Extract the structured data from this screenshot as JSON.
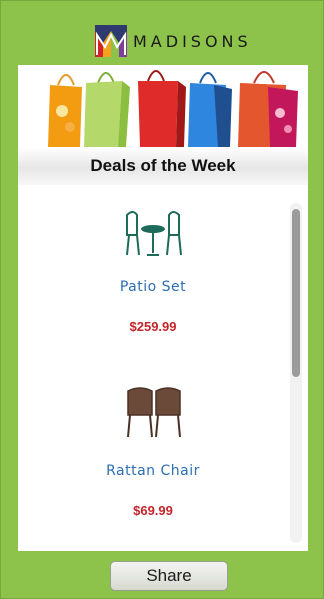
{
  "brand": {
    "name": "MADISONS",
    "logo_icon": "madisons-m-logo",
    "colors": {
      "frame_green": "#8dc24b",
      "link_blue": "#2c6fb3",
      "price_red": "#c3252a"
    }
  },
  "banner": {
    "icon": "shopping-bags-banner"
  },
  "section": {
    "title": "Deals of the Week"
  },
  "products": [
    {
      "name": "Patio Set",
      "price": "$259.99",
      "icon": "patio-set-icon"
    },
    {
      "name": "Rattan Chair",
      "price": "$69.99",
      "icon": "rattan-chair-icon"
    }
  ],
  "actions": {
    "share_label": "Share"
  }
}
